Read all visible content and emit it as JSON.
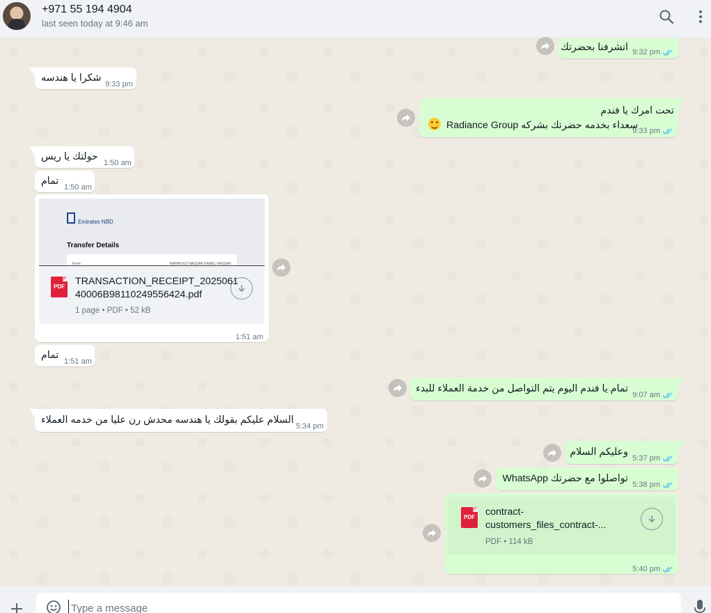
{
  "header": {
    "contact_name": "+971 55 194 4904",
    "status": "last seen today at 9:46 am",
    "search_icon": "search-icon",
    "menu_icon": "kebab-menu-icon"
  },
  "messages": [
    {
      "direction": "out",
      "text": "اتشرفنا بحضرتك",
      "time": "9:32 pm",
      "ticks": "double-check"
    },
    {
      "direction": "in",
      "text": "شكرا يا هندسه",
      "time": "9:33 pm"
    },
    {
      "direction": "out",
      "line1": "تحت امرك يا فندم",
      "line2": "سعداء بخدمه حضرتك بشركه Radiance Group",
      "emoji": "smiling-face-emoji",
      "time": "9:33 pm",
      "ticks": "double-check"
    },
    {
      "direction": "in",
      "text": "حولتك يا ريس",
      "time": "1:50 am"
    },
    {
      "direction": "in",
      "text": "تمام",
      "time": "1:50 am"
    },
    {
      "direction": "in",
      "type": "document",
      "preview": {
        "bank_name": "Emirates NBD",
        "heading": "Transfer Details",
        "from_label": "From",
        "from_value": "MAHMOUD NASSAR KAMEL NASSAR"
      },
      "filename_line1": "TRANSACTION_RECEIPT_2025061",
      "filename_line2": "40006B98110249556424.pdf",
      "icon_label": "PDF",
      "info": "1 page • PDF • 52 kB",
      "time": "1:51 am"
    },
    {
      "direction": "in",
      "text": "تمام",
      "time": "1:51 am"
    },
    {
      "direction": "out",
      "text": "تمام يا فندم اليوم يتم التواصل من خدمة العملاء للبدء",
      "time": "9:07 am",
      "ticks": "double-check"
    },
    {
      "direction": "in",
      "text": "السلام عليكم بقولك يا هندسه محدش رن عليا من خدمه العملاء",
      "time": "5:34 pm"
    },
    {
      "direction": "out",
      "text": "وعليكم السلام",
      "time": "5:37 pm",
      "ticks": "double-check"
    },
    {
      "direction": "out",
      "text": "تواصلوا مع حضرتك WhatsApp",
      "time": "5:38 pm",
      "ticks": "double-check"
    },
    {
      "direction": "out",
      "type": "document",
      "filename_line1": "contract-",
      "filename_line2": "customers_files_contract-...",
      "icon_label": "PDF",
      "info": "PDF • 114 kB",
      "time": "5:40 pm",
      "ticks": "double-check"
    }
  ],
  "composer": {
    "placeholder": "Type a message",
    "attach_icon": "plus-icon",
    "sticker_icon": "sticker-icon",
    "mic_icon": "mic-icon"
  },
  "colors": {
    "incoming_bubble": "#ffffff",
    "outgoing_bubble": "#d9fdd3",
    "chat_background": "#efeae2",
    "read_ticks": "#53bdeb",
    "pdf_red": "#e0213c"
  }
}
